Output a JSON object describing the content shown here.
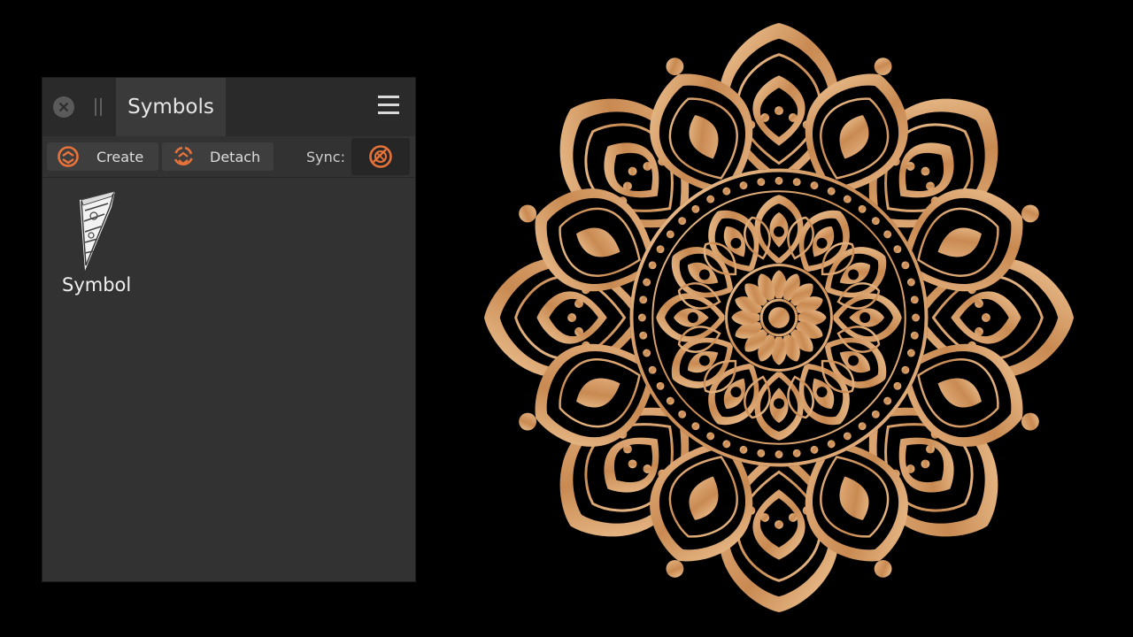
{
  "panel": {
    "tab_label": "Symbols",
    "icons": {
      "close": "close-icon",
      "grip": "drag-grip-icon",
      "menu": "hamburger-menu-icon"
    },
    "toolbar": {
      "create_label": "Create",
      "detach_label": "Detach",
      "sync_label": "Sync:",
      "create_icon": "create-symbol-icon",
      "detach_icon": "detach-symbol-icon",
      "sync_icon": "sync-symbol-icon"
    },
    "symbols": [
      {
        "name": "Symbol"
      }
    ]
  },
  "colors": {
    "accent": "#e8733a",
    "panel_bg": "#323232",
    "canvas_bg": "#000000",
    "artwork_gold": "#d49a63"
  },
  "canvas": {
    "artwork": "mandala"
  }
}
